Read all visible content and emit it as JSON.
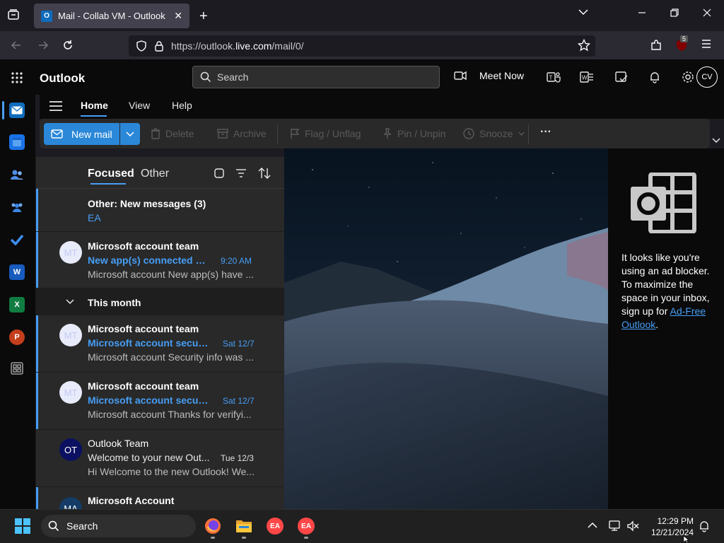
{
  "browser": {
    "tab_title": "Mail - Collab VM - Outlook",
    "url_prefix": "https://outlook.",
    "url_host": "live.com",
    "url_path": "/mail/0/",
    "ublock_count": "5"
  },
  "outlook": {
    "app_title": "Outlook",
    "search_placeholder": "Search",
    "meet_now": "Meet Now",
    "avatar_initials": "CV"
  },
  "ribbon": {
    "tabs": [
      "Home",
      "View",
      "Help"
    ],
    "new_mail": "New mail",
    "delete": "Delete",
    "archive": "Archive",
    "flag": "Flag / Unflag",
    "pin": "Pin / Unpin",
    "snooze": "Snooze",
    "more": "···"
  },
  "list": {
    "tab_focused": "Focused",
    "tab_other": "Other",
    "group_this_month": "This month",
    "other_notice": {
      "title": "Other: New messages (3)",
      "from": "EA"
    },
    "messages": [
      {
        "initials": "MT",
        "sender": "Microsoft account team",
        "subject": "New app(s) connected to...",
        "time": "9:20 AM",
        "preview": "Microsoft account New app(s) have ..."
      },
      {
        "initials": "MT",
        "sender": "Microsoft account team",
        "subject": "Microsoft account securit...",
        "time": "Sat 12/7",
        "preview": "Microsoft account Security info was ..."
      },
      {
        "initials": "MT",
        "sender": "Microsoft account team",
        "subject": "Microsoft account securit...",
        "time": "Sat 12/7",
        "preview": "Microsoft account Thanks for verifyi..."
      },
      {
        "initials": "OT",
        "sender": "Outlook Team",
        "subject": "Welcome to your new Out...",
        "time": "Tue 12/3",
        "preview": "Hi Welcome to the new Outlook! We..."
      },
      {
        "initials": "MA",
        "sender": "Microsoft Account",
        "subject": "",
        "time": "",
        "preview": ""
      }
    ]
  },
  "ad_blocker": {
    "message": "It looks like you're using an ad blocker. To maximize the space in your inbox, sign up for ",
    "link": "Ad-Free Outlook",
    "suffix": "."
  },
  "rail": {
    "word": "W",
    "excel": "X",
    "powerpoint": "P"
  },
  "taskbar": {
    "search": "Search",
    "time": "12:29 PM",
    "date": "12/21/2024",
    "ea_label": "EA"
  },
  "colors": {
    "accent": "#479ef5",
    "new_mail_bg": "#2b88d8",
    "pane_bg": "#292929"
  }
}
